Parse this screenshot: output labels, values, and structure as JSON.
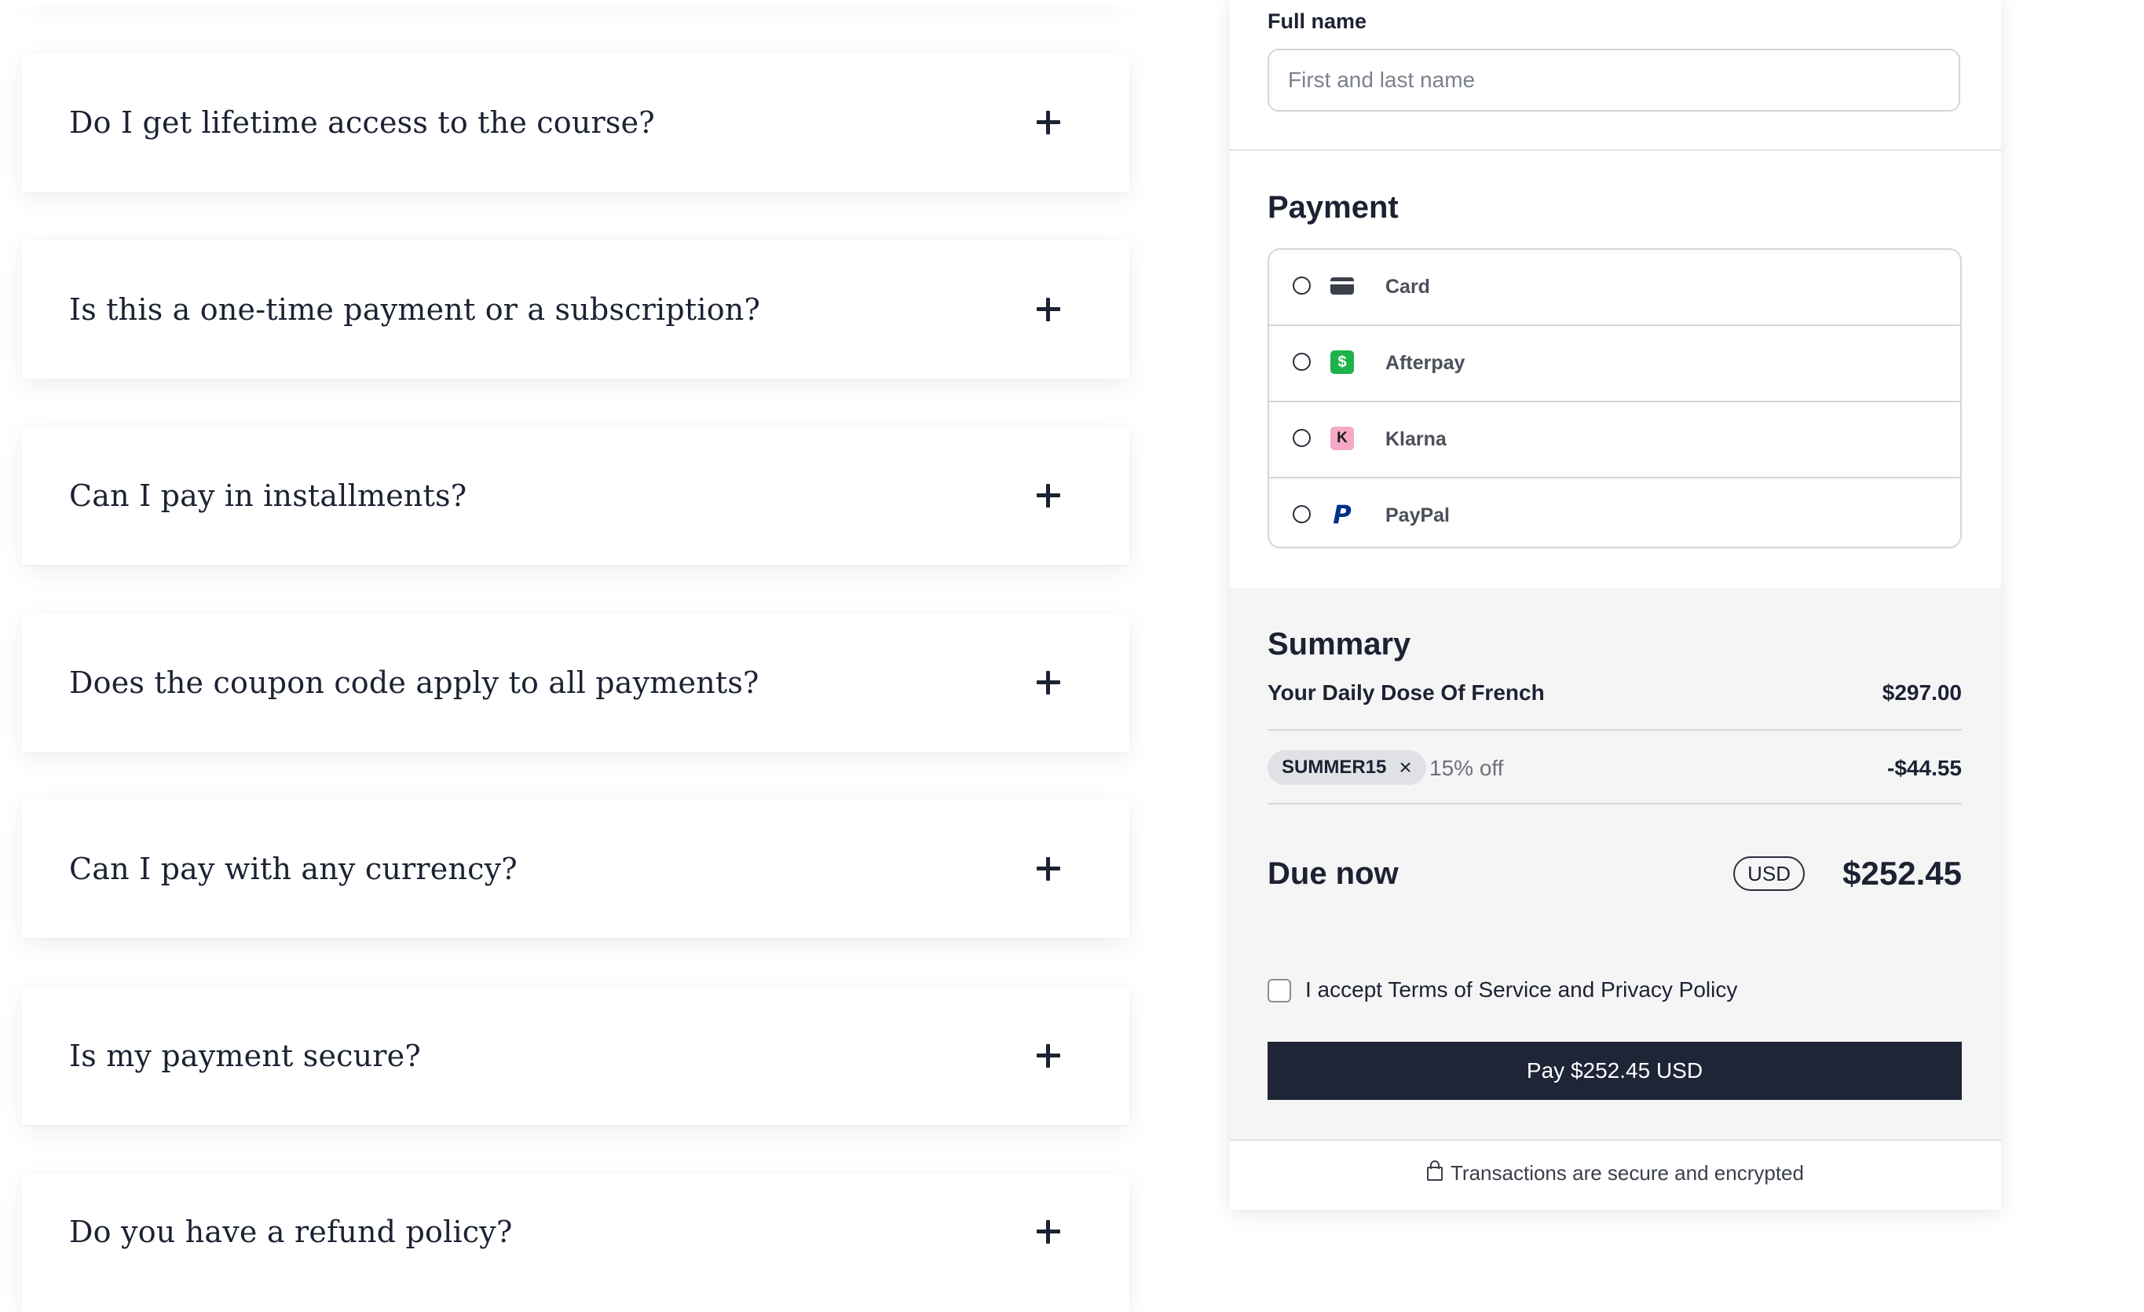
{
  "faq": {
    "items": [
      {
        "question": "Do I get lifetime access to the course?"
      },
      {
        "question": "Is this a one-time payment or a subscription?"
      },
      {
        "question": "Can I pay in installments?"
      },
      {
        "question": "Does the coupon code apply to all payments?"
      },
      {
        "question": "Can I pay with any currency?"
      },
      {
        "question": "Is my payment secure?"
      },
      {
        "question": "Do you have a refund policy?"
      }
    ]
  },
  "checkout": {
    "full_name": {
      "label": "Full name",
      "placeholder": "First and last name",
      "value": ""
    },
    "payment": {
      "title": "Payment",
      "methods": [
        {
          "label": "Card",
          "icon": "credit-card-icon"
        },
        {
          "label": "Afterpay",
          "icon": "afterpay-icon",
          "glyph": "$"
        },
        {
          "label": "Klarna",
          "icon": "klarna-icon",
          "glyph": "K"
        },
        {
          "label": "PayPal",
          "icon": "paypal-icon",
          "glyph": "P"
        }
      ]
    },
    "summary": {
      "title": "Summary",
      "product_name": "Your Daily Dose Of French",
      "product_price": "$297.00",
      "coupon_code": "SUMMER15",
      "coupon_remove": "×",
      "discount_text": "15% off",
      "discount_amount": "-$44.55",
      "due_label": "Due now",
      "currency": "USD",
      "due_amount": "$252.45"
    },
    "terms_label": "I accept Terms of Service and Privacy Policy",
    "pay_button": "Pay $252.45 USD",
    "secure_note": "Transactions are secure and encrypted"
  },
  "colors": {
    "primary_dark": "#1e2537",
    "afterpay_green": "#1cb34a",
    "klarna_pink": "#f5a9c6",
    "paypal_blue": "#003087",
    "summary_bg": "#f5f5f6"
  }
}
